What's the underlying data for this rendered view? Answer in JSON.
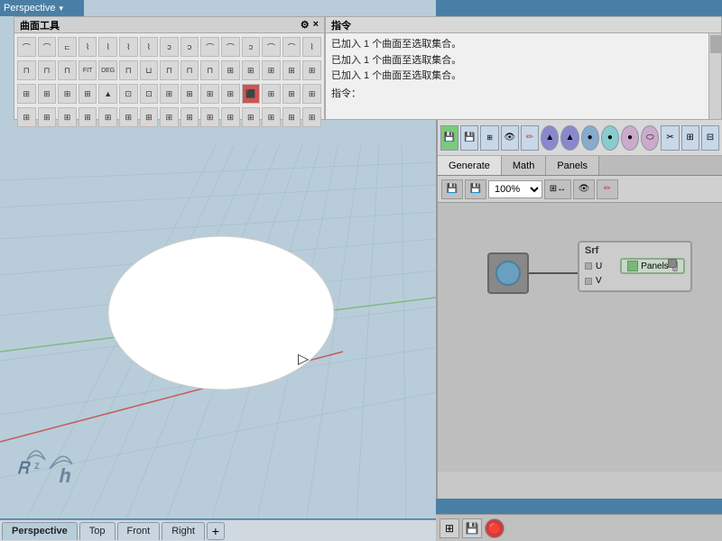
{
  "title": "Perspective",
  "toolbar": {
    "title": "曲面工具",
    "close_label": "×",
    "settings_label": "⚙"
  },
  "command": {
    "title": "指令",
    "lines": [
      "已加入 1 个曲面至选取集合。",
      "已加入 1 个曲面至选取集合。",
      "已加入 1 个曲面至选取集合。",
      "指令："
    ]
  },
  "gh": {
    "zoom": "100%",
    "tabs": [
      "Generate",
      "Math",
      "Panels"
    ],
    "node": {
      "label": "Srf",
      "params": [
        "U",
        "V"
      ],
      "panel_label": "Panels"
    },
    "status": ""
  },
  "tabs": [
    {
      "id": "perspective",
      "label": "Perspective",
      "active": true
    },
    {
      "id": "top",
      "label": "Top",
      "active": false
    },
    {
      "id": "front",
      "label": "Front",
      "active": false
    },
    {
      "id": "right",
      "label": "Right",
      "active": false
    }
  ],
  "icons": {
    "toolbar_rows": [
      [
        "⌒",
        "⌒",
        "⊏",
        "⌇",
        "⌇",
        "⌇",
        "⌇",
        "ↄ",
        "ↄ",
        "ↄ",
        "⌒",
        "⌒",
        "ↄ",
        "⌒",
        "⌒"
      ],
      [
        "⊓",
        "⊓",
        "⊓",
        "FIT",
        "DEG",
        "⊓",
        "⊓",
        "⊓",
        "⊓",
        "⊓",
        "⊓",
        "⊓",
        "⊓",
        "⊓",
        "⊓"
      ],
      [
        "⊞",
        "⊞",
        "⊞",
        "⊞",
        "⊞",
        "⊞",
        "⊞",
        "⊞",
        "⊞",
        "⊞",
        "⊞",
        "⊞",
        "⊞",
        "⊞",
        "⊞"
      ],
      [
        "⊞",
        "⊞",
        "⊞",
        "⊞",
        "⊞",
        "⊞",
        "⊞",
        "⊞",
        "⊞",
        "⊞",
        "⊞",
        "⊞",
        "⊞",
        "⊞",
        "⊞"
      ]
    ]
  }
}
